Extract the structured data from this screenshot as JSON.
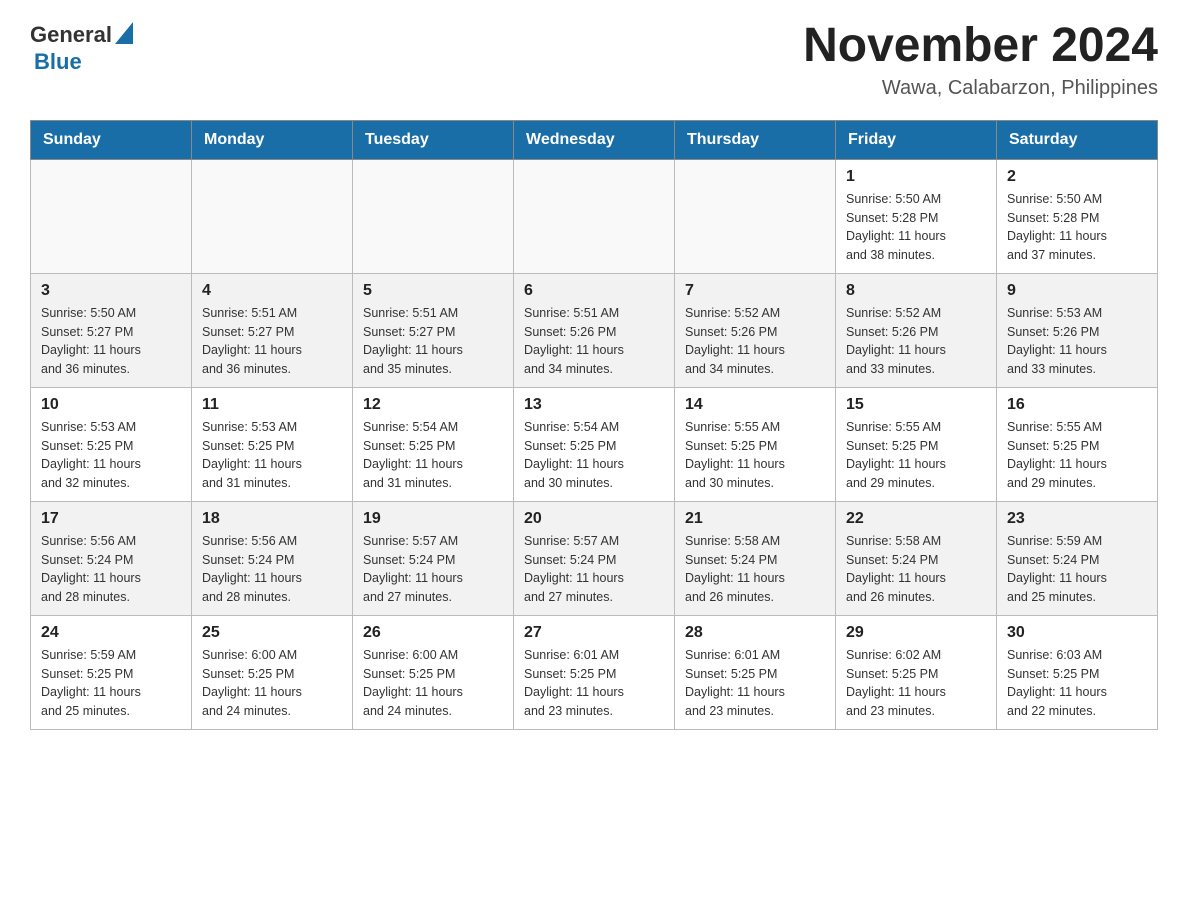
{
  "header": {
    "logo_general": "General",
    "logo_blue": "Blue",
    "title": "November 2024",
    "subtitle": "Wawa, Calabarzon, Philippines"
  },
  "weekdays": [
    "Sunday",
    "Monday",
    "Tuesday",
    "Wednesday",
    "Thursday",
    "Friday",
    "Saturday"
  ],
  "weeks": [
    [
      {
        "day": "",
        "info": ""
      },
      {
        "day": "",
        "info": ""
      },
      {
        "day": "",
        "info": ""
      },
      {
        "day": "",
        "info": ""
      },
      {
        "day": "",
        "info": ""
      },
      {
        "day": "1",
        "info": "Sunrise: 5:50 AM\nSunset: 5:28 PM\nDaylight: 11 hours\nand 38 minutes."
      },
      {
        "day": "2",
        "info": "Sunrise: 5:50 AM\nSunset: 5:28 PM\nDaylight: 11 hours\nand 37 minutes."
      }
    ],
    [
      {
        "day": "3",
        "info": "Sunrise: 5:50 AM\nSunset: 5:27 PM\nDaylight: 11 hours\nand 36 minutes."
      },
      {
        "day": "4",
        "info": "Sunrise: 5:51 AM\nSunset: 5:27 PM\nDaylight: 11 hours\nand 36 minutes."
      },
      {
        "day": "5",
        "info": "Sunrise: 5:51 AM\nSunset: 5:27 PM\nDaylight: 11 hours\nand 35 minutes."
      },
      {
        "day": "6",
        "info": "Sunrise: 5:51 AM\nSunset: 5:26 PM\nDaylight: 11 hours\nand 34 minutes."
      },
      {
        "day": "7",
        "info": "Sunrise: 5:52 AM\nSunset: 5:26 PM\nDaylight: 11 hours\nand 34 minutes."
      },
      {
        "day": "8",
        "info": "Sunrise: 5:52 AM\nSunset: 5:26 PM\nDaylight: 11 hours\nand 33 minutes."
      },
      {
        "day": "9",
        "info": "Sunrise: 5:53 AM\nSunset: 5:26 PM\nDaylight: 11 hours\nand 33 minutes."
      }
    ],
    [
      {
        "day": "10",
        "info": "Sunrise: 5:53 AM\nSunset: 5:25 PM\nDaylight: 11 hours\nand 32 minutes."
      },
      {
        "day": "11",
        "info": "Sunrise: 5:53 AM\nSunset: 5:25 PM\nDaylight: 11 hours\nand 31 minutes."
      },
      {
        "day": "12",
        "info": "Sunrise: 5:54 AM\nSunset: 5:25 PM\nDaylight: 11 hours\nand 31 minutes."
      },
      {
        "day": "13",
        "info": "Sunrise: 5:54 AM\nSunset: 5:25 PM\nDaylight: 11 hours\nand 30 minutes."
      },
      {
        "day": "14",
        "info": "Sunrise: 5:55 AM\nSunset: 5:25 PM\nDaylight: 11 hours\nand 30 minutes."
      },
      {
        "day": "15",
        "info": "Sunrise: 5:55 AM\nSunset: 5:25 PM\nDaylight: 11 hours\nand 29 minutes."
      },
      {
        "day": "16",
        "info": "Sunrise: 5:55 AM\nSunset: 5:25 PM\nDaylight: 11 hours\nand 29 minutes."
      }
    ],
    [
      {
        "day": "17",
        "info": "Sunrise: 5:56 AM\nSunset: 5:24 PM\nDaylight: 11 hours\nand 28 minutes."
      },
      {
        "day": "18",
        "info": "Sunrise: 5:56 AM\nSunset: 5:24 PM\nDaylight: 11 hours\nand 28 minutes."
      },
      {
        "day": "19",
        "info": "Sunrise: 5:57 AM\nSunset: 5:24 PM\nDaylight: 11 hours\nand 27 minutes."
      },
      {
        "day": "20",
        "info": "Sunrise: 5:57 AM\nSunset: 5:24 PM\nDaylight: 11 hours\nand 27 minutes."
      },
      {
        "day": "21",
        "info": "Sunrise: 5:58 AM\nSunset: 5:24 PM\nDaylight: 11 hours\nand 26 minutes."
      },
      {
        "day": "22",
        "info": "Sunrise: 5:58 AM\nSunset: 5:24 PM\nDaylight: 11 hours\nand 26 minutes."
      },
      {
        "day": "23",
        "info": "Sunrise: 5:59 AM\nSunset: 5:24 PM\nDaylight: 11 hours\nand 25 minutes."
      }
    ],
    [
      {
        "day": "24",
        "info": "Sunrise: 5:59 AM\nSunset: 5:25 PM\nDaylight: 11 hours\nand 25 minutes."
      },
      {
        "day": "25",
        "info": "Sunrise: 6:00 AM\nSunset: 5:25 PM\nDaylight: 11 hours\nand 24 minutes."
      },
      {
        "day": "26",
        "info": "Sunrise: 6:00 AM\nSunset: 5:25 PM\nDaylight: 11 hours\nand 24 minutes."
      },
      {
        "day": "27",
        "info": "Sunrise: 6:01 AM\nSunset: 5:25 PM\nDaylight: 11 hours\nand 23 minutes."
      },
      {
        "day": "28",
        "info": "Sunrise: 6:01 AM\nSunset: 5:25 PM\nDaylight: 11 hours\nand 23 minutes."
      },
      {
        "day": "29",
        "info": "Sunrise: 6:02 AM\nSunset: 5:25 PM\nDaylight: 11 hours\nand 23 minutes."
      },
      {
        "day": "30",
        "info": "Sunrise: 6:03 AM\nSunset: 5:25 PM\nDaylight: 11 hours\nand 22 minutes."
      }
    ]
  ]
}
